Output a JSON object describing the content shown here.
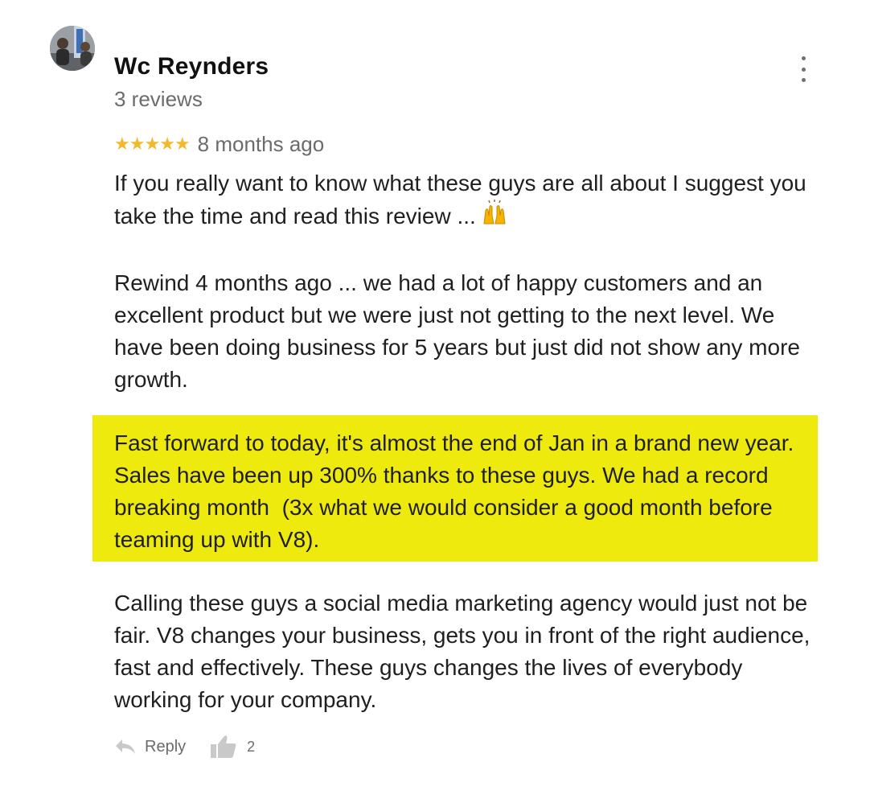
{
  "reviewer": {
    "name": "Wc Reynders",
    "review_count": "3 reviews",
    "avatar_icon": "profile-photo"
  },
  "review": {
    "rating": 5,
    "rating_max": 5,
    "stars": "★★★★★",
    "date": "8 months ago",
    "paragraphs": [
      "If you really want to know what these guys are all about I suggest you take the time and read this review ...",
      "Rewind 4 months ago ... we had a lot of happy customers and an excellent product but we were just not getting to the next level. We have been doing business for 5 years but just did not show any more growth.",
      "Fast forward to today, it's almost the end of Jan in a brand new year. Sales have been up 300% thanks to these guys. We had a record breaking month  (3x what we would consider a good month before teaming up with V8).",
      "Calling these guys a social media marketing agency would just not be fair. V8 changes your business, gets you in front of the right audience, fast and effectively. These guys changes the lives of everybody working for your company."
    ],
    "emoji_icon": "raising-hands-emoji",
    "highlight_color": "#eeea0e",
    "star_color": "#f2b92e"
  },
  "actions": {
    "reply_label": "Reply",
    "like_count": "2"
  },
  "menu_icon": "more-vertical-icon"
}
